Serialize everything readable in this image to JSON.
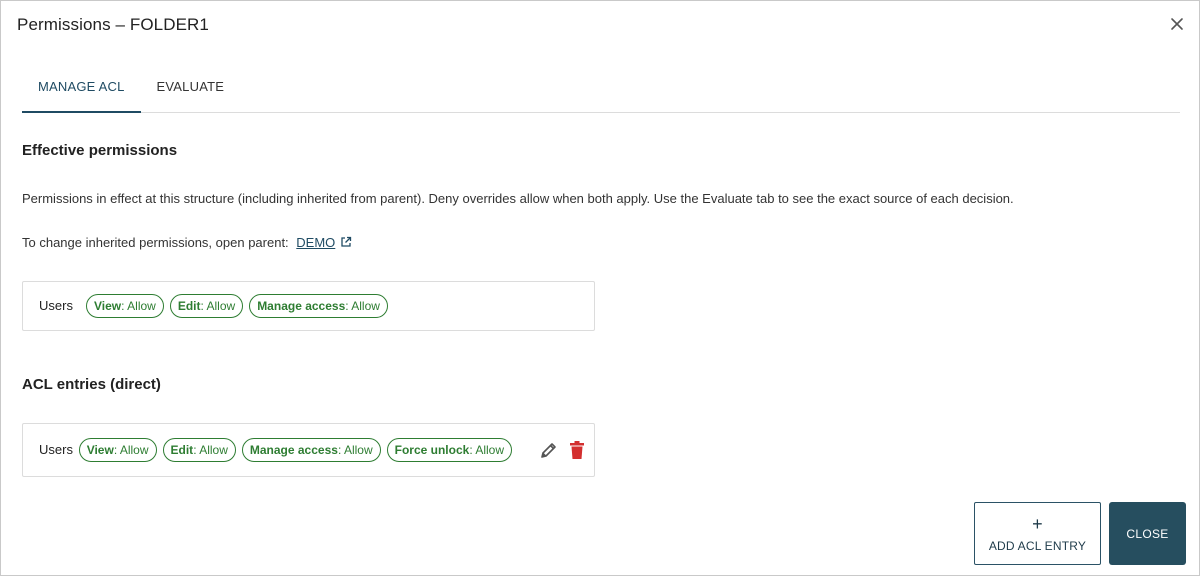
{
  "dialog": {
    "title": "Permissions – FOLDER1",
    "tabs": [
      {
        "label": "MANAGE ACL",
        "active": true
      },
      {
        "label": "EVALUATE",
        "active": false
      }
    ]
  },
  "effective": {
    "heading": "Effective permissions",
    "description": "Permissions in effect at this structure (including inherited from parent). Deny overrides allow when both apply. Use the Evaluate tab to see the exact source of each decision.",
    "parent_prefix": "To change inherited permissions, open parent:",
    "parent_link": "DEMO",
    "row": {
      "principal": "Users",
      "chips": [
        {
          "name": "View",
          "value": ": Allow"
        },
        {
          "name": "Edit",
          "value": ": Allow"
        },
        {
          "name": "Manage access",
          "value": ": Allow"
        }
      ]
    }
  },
  "acl": {
    "heading": "ACL entries (direct)",
    "row": {
      "principal": "Users",
      "chips": [
        {
          "name": "View",
          "value": ": Allow"
        },
        {
          "name": "Edit",
          "value": ": Allow"
        },
        {
          "name": "Manage access",
          "value": ": Allow"
        },
        {
          "name": "Force unlock",
          "value": ": Allow"
        }
      ],
      "edit_icon": "pencil-icon",
      "delete_icon": "trash-icon"
    }
  },
  "footer": {
    "add_plus": "+",
    "add_label": "ADD ACL ENTRY",
    "close_label": "CLOSE"
  },
  "colors": {
    "accent": "#1f4b63",
    "allow_chip": "#2e7d32",
    "delete": "#d32f2f",
    "close_button": "#264e5f"
  }
}
